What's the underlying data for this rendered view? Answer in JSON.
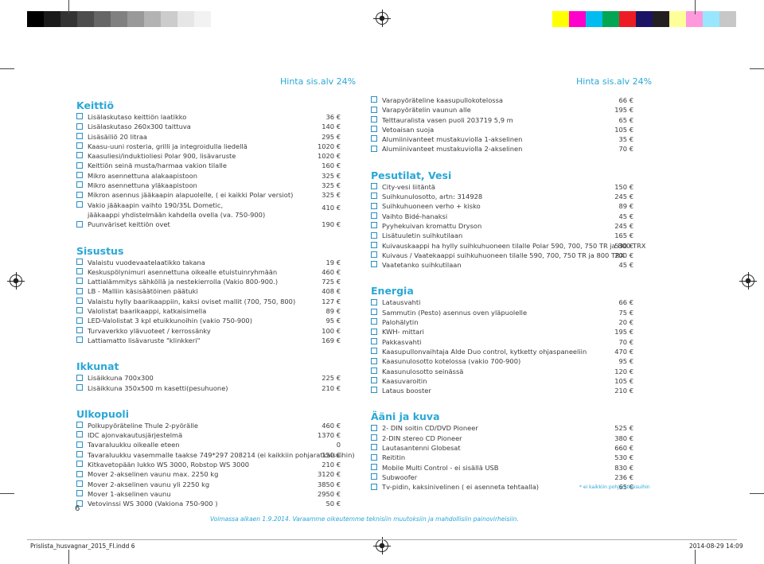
{
  "colors": {
    "accent": "#2aa7d6",
    "checkbox": "#2a8ec2",
    "text": "#3a3a3a"
  },
  "greys": [
    "#000000",
    "#1a1a1a",
    "#333333",
    "#4d4d4d",
    "#666666",
    "#808080",
    "#999999",
    "#b3b3b3",
    "#cccccc",
    "#e6e6e6",
    "#f2f2f2"
  ],
  "swatches": [
    "#ffff00",
    "#ff00cc",
    "#00bcf0",
    "#00a651",
    "#ed1c24",
    "#1b1464",
    "#231f20",
    "#ffff99",
    "#ff99dd",
    "#99e6ff",
    "#c7c7c7"
  ],
  "hints": {
    "left": "Hinta sis.alv 24%",
    "right": "Hinta sis.alv 24%"
  },
  "left_sections": [
    {
      "title": "Keittiö",
      "rows": [
        {
          "label": "Lisälaskutaso keittiön laatikko",
          "price": "36 €"
        },
        {
          "label": "Lisälaskutaso 260x300 taittuva",
          "price": "140 €"
        },
        {
          "label": "Lisäsäiliö 20 litraa",
          "price": "295 €"
        },
        {
          "label": "Kaasu-uuni rosteria, grilli ja integroidulla liedellä",
          "price": "1020 €"
        },
        {
          "label": "Kaasuliesi/induktioliesi Polar 900, lisävaruste",
          "price": "1020 €"
        },
        {
          "label": "Keittiön seinä musta/harmaa vakion tilalle",
          "price": "160 €"
        },
        {
          "label": "Mikro asennettuna alakaapistoon",
          "price": "325 €"
        },
        {
          "label": "Mikro asennettuna yläkaapistoon",
          "price": "325 €"
        },
        {
          "label": "Mikron asennus jääkaapin alapuolelle, ( ei kaikki Polar versiot)",
          "price": "325 €"
        },
        {
          "label": "Vakio jääkaapin vaihto 190/35L Dometic,",
          "price": "410 €",
          "cont": "jääkaappi yhdistelmään  kahdella ovella (va. 750-900)"
        },
        {
          "label": "Puunväriset keittiön ovet",
          "price": "190 €"
        }
      ]
    },
    {
      "title": "Sisustus",
      "rows": [
        {
          "label": "Valaistu vuodevaatelaatikko takana",
          "price": "19 €"
        },
        {
          "label": "Keskuspölynimuri asennettuna oikealle etuistuinryhmään",
          "price": "460 €"
        },
        {
          "label": "Lattialämmitys sähköllä ja nestekierrolla (Vakio 800-900.)",
          "price": "725 €"
        },
        {
          "label": "LB - Malliin käsisäätöinen päätuki",
          "price": "408 €"
        },
        {
          "label": "Valaistu hylly baarikaappiin, kaksi oviset mallit (700, 750, 800)",
          "price": "127 €"
        },
        {
          "label": "Valolistat baarikaappi, katkaisimella",
          "price": "89 €"
        },
        {
          "label": "LED-Valolistat 3 kpl etuikkunoihin (vakio 750-900)",
          "price": "95 €"
        },
        {
          "label": "Turvaverkko ylävuoteet / kerrossänky",
          "price": "100 €"
        },
        {
          "label": "Lattiamatto lisävaruste \"klinkkeri\"",
          "price": "169 €"
        }
      ]
    },
    {
      "title": "Ikkunat",
      "rows": [
        {
          "label": "Lisäikkuna 700x300",
          "price": "225 €"
        },
        {
          "label": "Lisäikkuna 350x500 m kasetti(pesuhuone)",
          "price": "210 €"
        }
      ]
    },
    {
      "title": "Ulkopuoli",
      "rows": [
        {
          "label": "Polkupyöräteline Thule 2-pyörälle",
          "price": "460 €"
        },
        {
          "label": "IDC ajonvakautusjärjestelmä",
          "price": "1370 €"
        },
        {
          "label": "Tavaraluukku oikealle eteen",
          "price": "0"
        },
        {
          "label": "Tavaraluukku vasemmalle taakse 749*297 208214 (ei kaikkiin pohjaratkaisuihin)",
          "price": "150 €"
        },
        {
          "label": "Kitkavetopään lukko WS 3000, Robstop WS 3000",
          "price": "210 €"
        },
        {
          "label": "Mover 2-akselinen vaunu max. 2250 kg",
          "price": "3120 €"
        },
        {
          "label": "Mover 2-akselinen vaunu yli 2250 kg",
          "price": "3850 €"
        },
        {
          "label": "Mover 1-akselinen vaunu",
          "price": "2950 €"
        },
        {
          "label": "Vetovinssi WS 3000 (Vakiona 750-900 )",
          "price": "50 €"
        }
      ]
    }
  ],
  "right_sections": [
    {
      "title": "",
      "rows": [
        {
          "label": "Varapyöräteline kaasupullokotelossa",
          "price": "66 €"
        },
        {
          "label": "Varapyörätelin vaunun alle",
          "price": "195 €"
        },
        {
          "label": "Telttauralista vasen puoli 203719  5,9 m",
          "price": "65 €"
        },
        {
          "label": "Vetoaisan suoja",
          "price": "105 €"
        },
        {
          "label": "Alumiinivanteet mustakuviolla 1-akselinen",
          "price": "35 €"
        },
        {
          "label": "Alumiinivanteet mustakuviolla 2-akselinen",
          "price": "70 €"
        }
      ]
    },
    {
      "title": "Pesutilat, Vesi",
      "rows": [
        {
          "label": "City-vesi liitäntä",
          "price": "150 €"
        },
        {
          "label": "Suihkunulosotto, artn: 314928",
          "price": "245 €"
        },
        {
          "label": "Suihkuhuoneen verho + kisko",
          "price": "89 €"
        },
        {
          "label": "Vaihto Bidé-hanaksi",
          "price": "45 €"
        },
        {
          "label": "Pyyhekuivan kromattu Dryson",
          "price": "245 €"
        },
        {
          "label": "Lisätuuletin suihkutilaan",
          "price": "165 €"
        },
        {
          "label": "Kuivauskaappi ha hylly suihkuhuoneen tilalle Polar 590, 700, 750 TR ja 800 TRX",
          "price": "530 €"
        },
        {
          "label": "Kuivaus / Vaatekaappi suihkuhuoneen tilalle 590, 700, 750 TR ja 800 TRX",
          "price": "200 €"
        },
        {
          "label": "Vaatetanko suihkutilaan",
          "price": "45 €"
        }
      ]
    },
    {
      "title": "Energia",
      "rows": [
        {
          "label": "Latausvahti",
          "price": "66 €"
        },
        {
          "label": "Sammutin (Pesto) asennus oven yläpuolelle",
          "price": "75 €"
        },
        {
          "label": "Palohälytin",
          "price": "20 €"
        },
        {
          "label": "KWH- mittari",
          "price": "195 €"
        },
        {
          "label": "Pakkasvahti",
          "price": "70 €"
        },
        {
          "label": "Kaasupullonvaihtaja Alde Duo control, kytketty ohjaspaneeliin",
          "price": "470 €"
        },
        {
          "label": "Kaasunulosotto kotelossa (vakio 700-900)",
          "price": "95 €"
        },
        {
          "label": "Kaasunulosotto seinässä",
          "price": "120 €"
        },
        {
          "label": "Kaasuvaroitin",
          "price": "105 €"
        },
        {
          "label": "Lataus booster",
          "price": "210 €"
        }
      ]
    },
    {
      "title": "Ääni ja kuva",
      "rows": [
        {
          "label": "2- DIN soitin CD/DVD Pioneer",
          "price": "525 €"
        },
        {
          "label": "2-DIN stereo CD Pioneer",
          "price": "380 €"
        },
        {
          "label": "Lautasantenni Globesat",
          "price": "660 €"
        },
        {
          "label": "Reititin",
          "price": "530 €"
        },
        {
          "label": "Mobile Multi Control - ei sisällä USB",
          "price": "830 €"
        },
        {
          "label": "Subwoofer",
          "price": "236 €"
        },
        {
          "label": "Tv-pidin, kaksinivelinen ( ei asenneta tehtaalla)",
          "price": "65 €"
        }
      ]
    }
  ],
  "footnote": "* ei kaikkiin pohjaratkaisuihin",
  "page_number": "6",
  "validity": "Voimassa alkaen 1.9.2014. Varaamme oikeutemme teknisiin muutoksiin ja mahdollisiin painovirheisiin.",
  "slug": {
    "file": "Prislista_husvagnar_2015_FI.indd   6",
    "date": "2014-08-29   14:09"
  }
}
